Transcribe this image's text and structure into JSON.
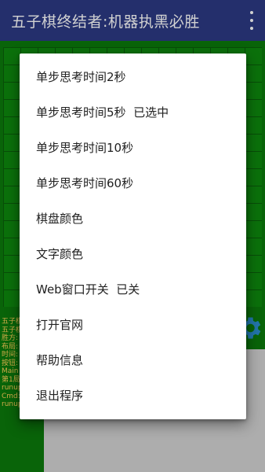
{
  "appbar": {
    "title": "五子棋终结者:机器执黑必胜",
    "overflow_icon": "more-vert-icon"
  },
  "background": {
    "side_panel_lines": [
      "五子棋",
      "五子棋",
      "胜方:",
      "布局:",
      "时间:",
      "按钮:",
      "Main",
      "第1局",
      "runup",
      "Cmd:",
      "runup"
    ]
  },
  "menu": {
    "items": [
      "单步思考时间2秒",
      "单步思考时间5秒  已选中",
      "单步思考时间10秒",
      "单步思考时间60秒",
      "棋盘颜色",
      "文字颜色",
      "Web窗口开关  已关",
      "打开官网",
      "帮助信息",
      "退出程序"
    ]
  },
  "colors": {
    "appbar": "#2c3a84",
    "board_bg": "#0b7a0b",
    "menu_bg": "#ffffff",
    "side_text": "#ffd25a"
  }
}
